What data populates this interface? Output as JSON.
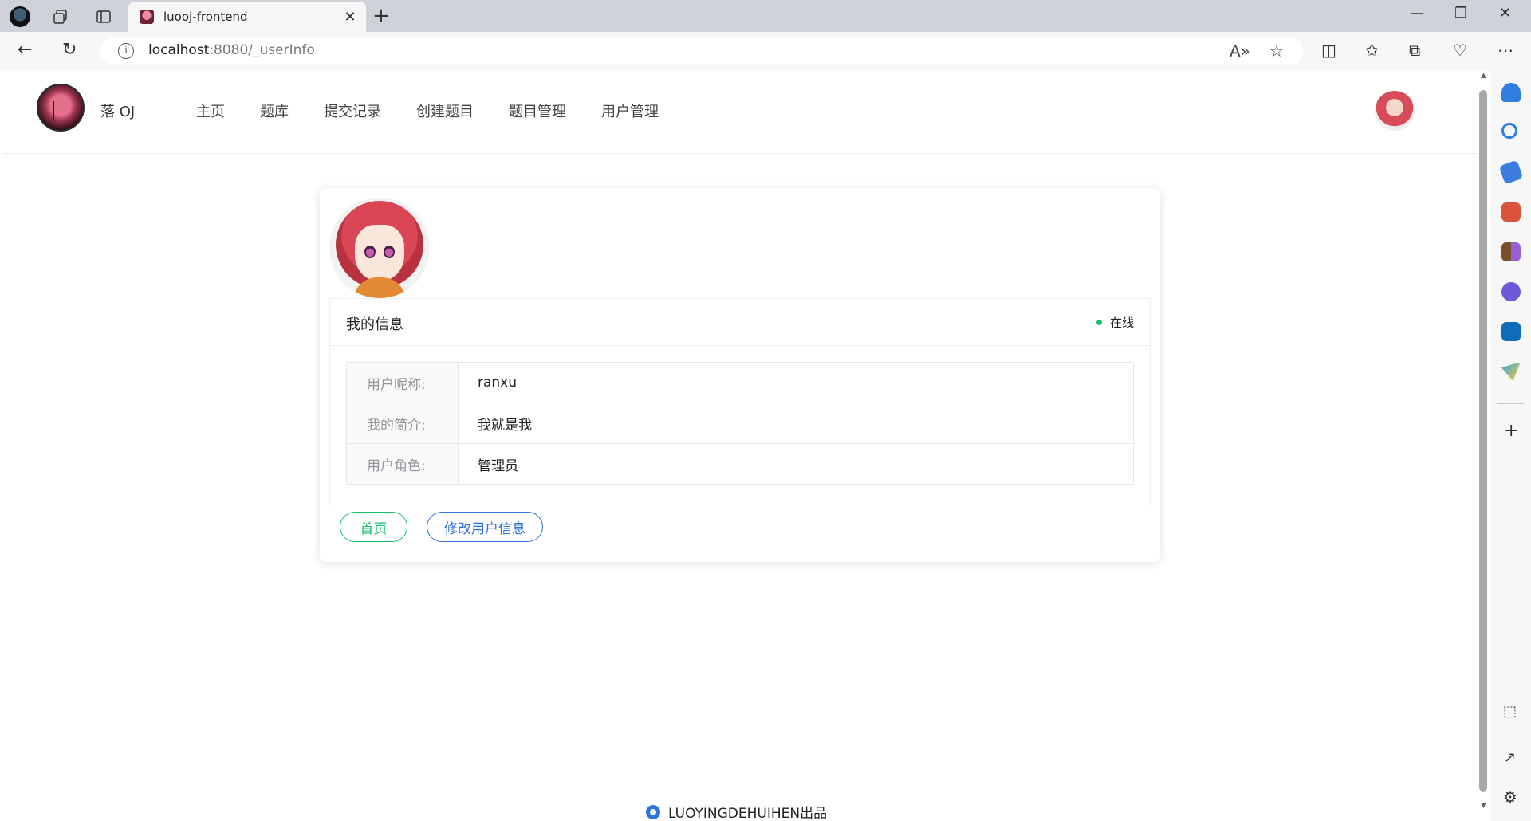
{
  "browser": {
    "tab_title": "luooj-frontend",
    "url_host": "localhost",
    "url_rest": ":8080/_userInfo"
  },
  "header": {
    "brand": "落 OJ",
    "menu": [
      "主页",
      "题库",
      "提交记录",
      "创建题目",
      "题目管理",
      "用户管理"
    ]
  },
  "profile": {
    "section_title": "我的信息",
    "status": "在线",
    "rows": [
      {
        "label": "用户昵称:",
        "value": "ranxu"
      },
      {
        "label": "我的简介:",
        "value": "我就是我"
      },
      {
        "label": "用户角色:",
        "value": "管理员"
      }
    ],
    "home_button": "首页",
    "edit_button": "修改用户信息"
  },
  "footer": {
    "text": "LUOYINGDEHUIHEN出品"
  },
  "colors": {
    "success": "#19be6b",
    "primary": "#2d73d9"
  }
}
